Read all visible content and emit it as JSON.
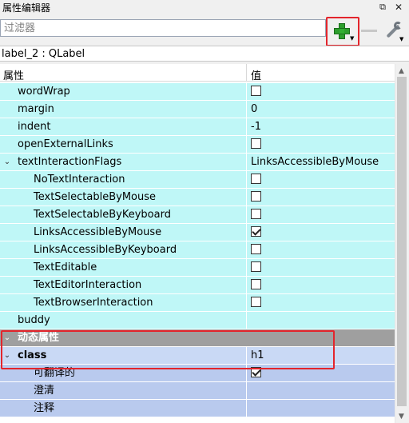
{
  "panel": {
    "title": "属性编辑器",
    "float_glyph": "⧉",
    "close_glyph": "✕"
  },
  "toolbar": {
    "filter_placeholder": "过滤器",
    "add_icon": "plus-icon",
    "remove_icon": "minus-icon",
    "tool_icon": "wrench-icon"
  },
  "object_name": "label_2 : QLabel",
  "columns": {
    "property": "属性",
    "value": "值"
  },
  "rows": {
    "wordWrap": {
      "label": "wordWrap",
      "checked": false
    },
    "margin": {
      "label": "margin",
      "value": "0"
    },
    "indent": {
      "label": "indent",
      "value": "-1"
    },
    "openExternalLinks": {
      "label": "openExternalLinks",
      "checked": false
    },
    "textInteractionFlags": {
      "label": "textInteractionFlags",
      "value": "LinksAccessibleByMouse",
      "expand_glyph": "⌄"
    },
    "NoTextInteraction": {
      "label": "NoTextInteraction",
      "checked": false
    },
    "TextSelectableByMouse": {
      "label": "TextSelectableByMouse",
      "checked": false
    },
    "TextSelectableByKeyboard": {
      "label": "TextSelectableByKeyboard",
      "checked": false
    },
    "LinksAccessibleByMouse": {
      "label": "LinksAccessibleByMouse",
      "checked": true
    },
    "LinksAccessibleByKeyboard": {
      "label": "LinksAccessibleByKeyboard",
      "checked": false
    },
    "TextEditable": {
      "label": "TextEditable",
      "checked": false
    },
    "TextEditorInteraction": {
      "label": "TextEditorInteraction",
      "checked": false
    },
    "TextBrowserInteraction": {
      "label": "TextBrowserInteraction",
      "checked": false
    },
    "buddy": {
      "label": "buddy",
      "value": ""
    },
    "dynamic": {
      "label": "动态属性",
      "expand_glyph": "⌄"
    },
    "class": {
      "label": "class",
      "value": "h1",
      "expand_glyph": "⌄"
    },
    "translatable": {
      "label": "可翻译的",
      "checked": true
    },
    "disambiguation": {
      "label": "澄清",
      "value": ""
    },
    "comment": {
      "label": "注释",
      "value": ""
    }
  },
  "colors": {
    "annotation": "#e3252c",
    "designable": "#bff7f7",
    "dynamic_header": "#9f9f9f",
    "dynamic_rows": "#c9d9f5"
  }
}
